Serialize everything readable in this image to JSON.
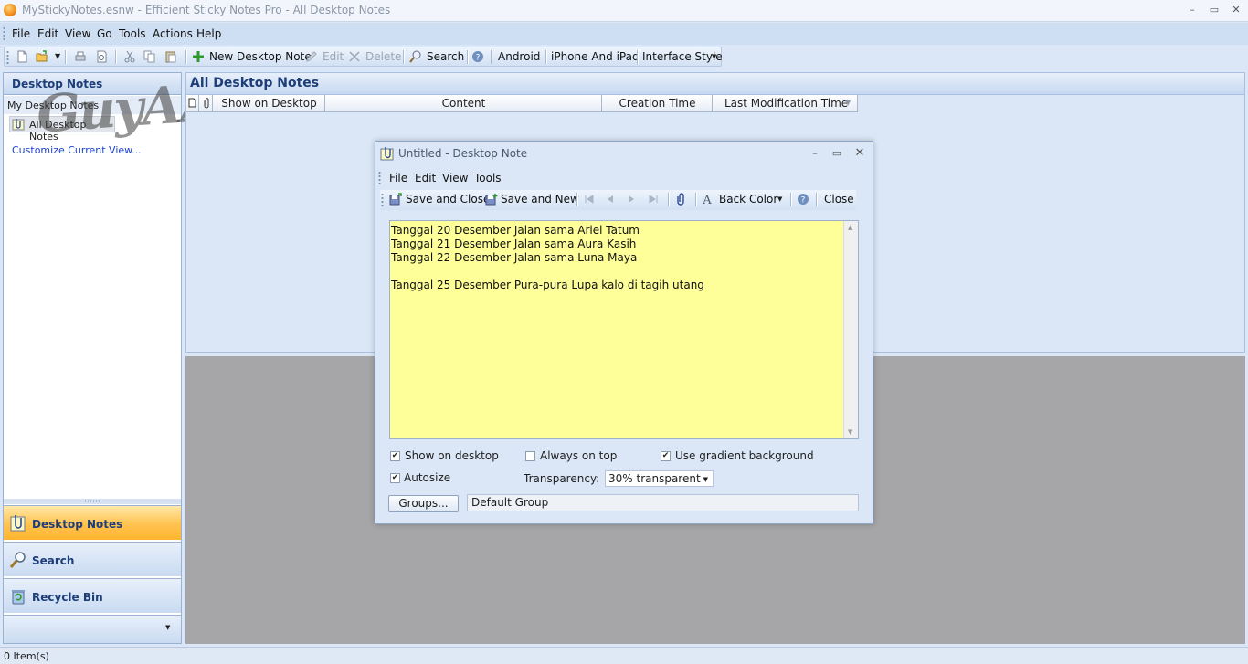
{
  "window": {
    "title": "MyStickyNotes.esnw - Efficient Sticky Notes Pro - All Desktop Notes",
    "min_glyph": "–",
    "max_glyph": "▭",
    "close_glyph": "✕"
  },
  "menubar": {
    "items": [
      "File",
      "Edit",
      "View",
      "Go",
      "Tools",
      "Actions",
      "Help"
    ]
  },
  "toolbar": {
    "new_desktop_note": "New Desktop Note",
    "edit": "Edit",
    "delete": "Delete",
    "search": "Search",
    "android": "Android",
    "iphone_ipad": "iPhone And iPad",
    "interface_style": "Interface Style"
  },
  "sidebar": {
    "header": "Desktop Notes",
    "tree_root": "My Desktop Notes",
    "tree_selected": "All Desktop Notes",
    "customize_link": "Customize Current View...",
    "nav_buttons": [
      {
        "label": "Desktop Notes",
        "active": true
      },
      {
        "label": "Search",
        "active": false
      },
      {
        "label": "Recycle Bin",
        "active": false
      }
    ]
  },
  "main": {
    "header": "All Desktop Notes",
    "columns": [
      "Show on Desktop",
      "Content",
      "Creation Time",
      "Last Modification Time"
    ]
  },
  "statusbar": {
    "items_count": "0 Item(s)"
  },
  "dialog": {
    "title": "Untitled - Desktop Note",
    "menu": [
      "File",
      "Edit",
      "View",
      "Tools"
    ],
    "toolbar": {
      "save_and_close": "Save and Close",
      "save_and_new": "Save and New",
      "back_color": "Back Color",
      "close": "Close"
    },
    "note_text": "Tanggal 20 Desember Jalan sama Ariel Tatum\nTanggal 21 Desember Jalan sama Aura Kasih\nTanggal 22 Desember Jalan sama Luna Maya\n\nTanggal 25 Desember Pura-pura Lupa kalo di tagih utang",
    "note_color": "#ffff99",
    "options": {
      "show_on_desktop": "Show on desktop",
      "show_on_desktop_checked": true,
      "always_on_top": "Always on top",
      "always_on_top_checked": false,
      "use_gradient": "Use gradient background",
      "use_gradient_checked": true,
      "autosize": "Autosize",
      "autosize_checked": true,
      "transparency_label": "Transparency:",
      "transparency_value": "30% transparent"
    },
    "groups_button": "Groups...",
    "group_value": "Default Group"
  },
  "watermark": "GuyAA.Me",
  "colors": {
    "accent": "#1d3e78",
    "active_nav": "#ffc24f",
    "link": "#1a3fd0"
  }
}
